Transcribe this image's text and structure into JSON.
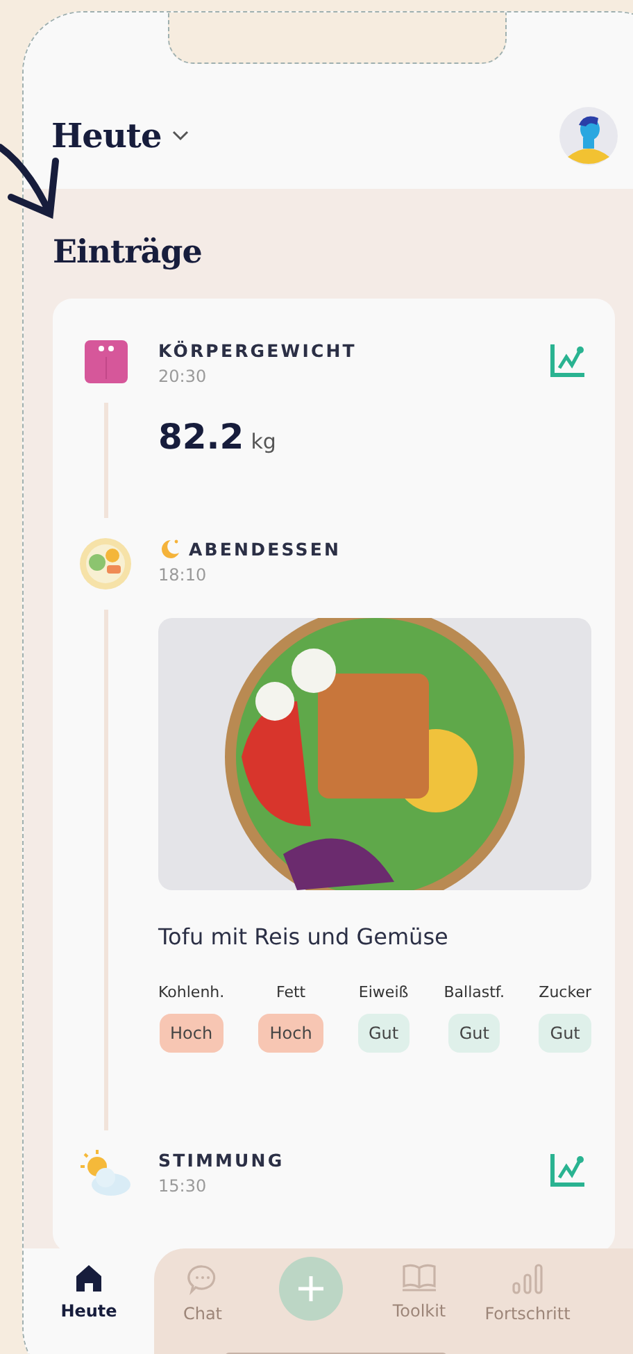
{
  "header": {
    "title": "Heute"
  },
  "section_title": "Einträge",
  "entries": [
    {
      "kind": "weight",
      "title": "KÖRPERGEWICHT",
      "time": "20:30",
      "value": "82.2",
      "unit": "kg",
      "has_chart": true
    },
    {
      "kind": "meal",
      "title": "ABENDESSEN",
      "time": "18:10",
      "dish": "Tofu mit Reis und Gemüse",
      "nutrients": [
        {
          "label": "Kohlenh.",
          "rating": "Hoch",
          "kind": "high"
        },
        {
          "label": "Fett",
          "rating": "Hoch",
          "kind": "high"
        },
        {
          "label": "Eiweiß",
          "rating": "Gut",
          "kind": "good"
        },
        {
          "label": "Ballastf.",
          "rating": "Gut",
          "kind": "good"
        },
        {
          "label": "Zucker",
          "rating": "Gut",
          "kind": "good"
        }
      ]
    },
    {
      "kind": "mood",
      "title": "STIMMUNG",
      "time": "15:30",
      "has_chart": true
    }
  ],
  "nav": [
    {
      "kind": "home",
      "label": "Heute",
      "selected": true
    },
    {
      "kind": "chat",
      "label": "Chat",
      "selected": false
    },
    {
      "kind": "add",
      "selected": false
    },
    {
      "kind": "toolkit",
      "label": "Toolkit",
      "selected": false
    },
    {
      "kind": "progress",
      "label": "Fortschritt",
      "selected": false
    }
  ]
}
